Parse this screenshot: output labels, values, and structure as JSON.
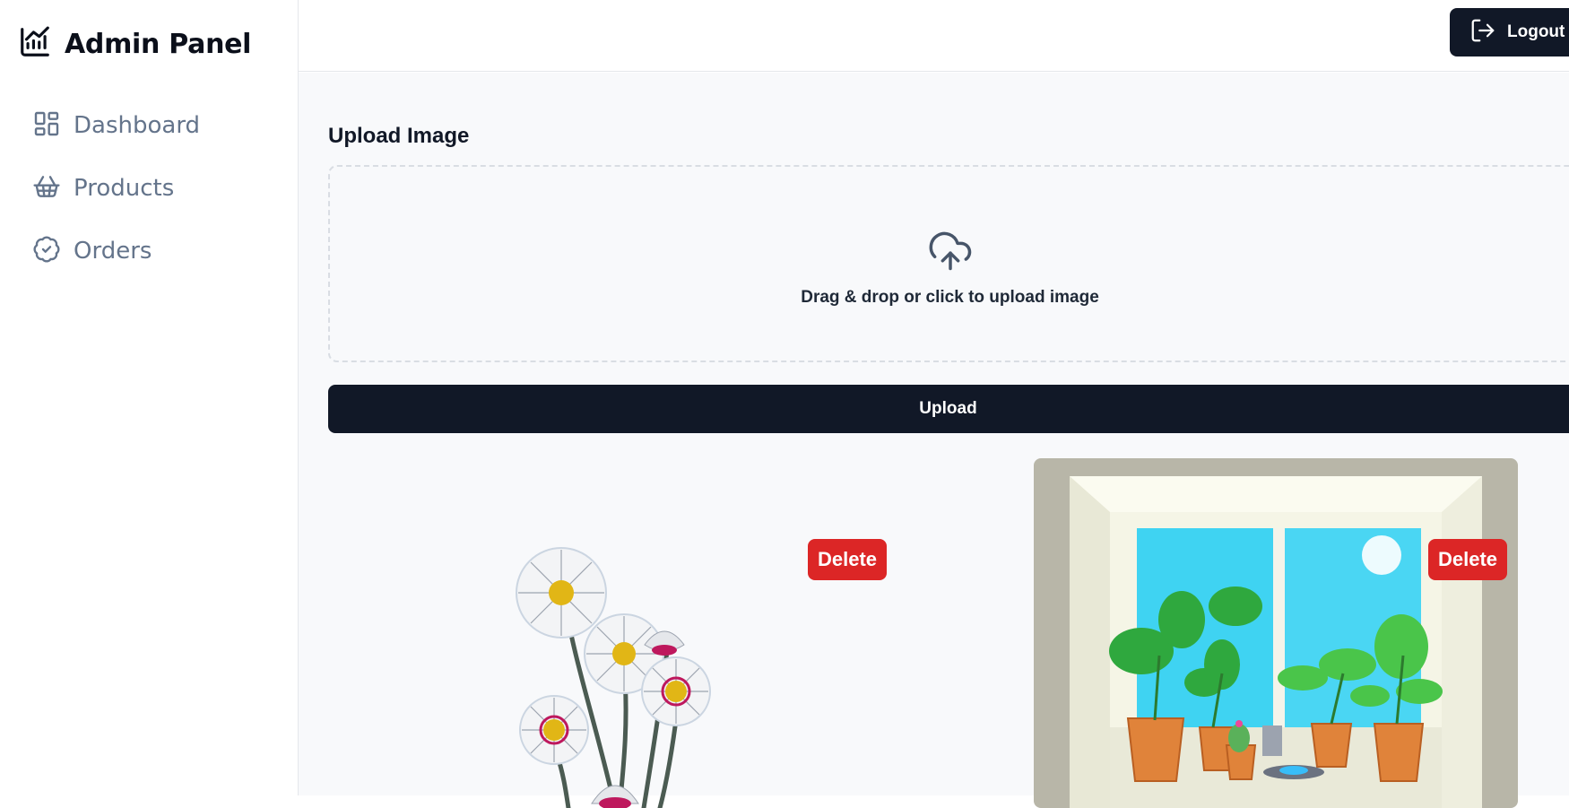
{
  "sidebar": {
    "brand_title": "Admin Panel",
    "brand_icon": "chart-line-icon",
    "items": [
      {
        "label": "Dashboard",
        "icon": "layout-dashboard-icon"
      },
      {
        "label": "Products",
        "icon": "shopping-basket-icon"
      },
      {
        "label": "Orders",
        "icon": "badge-check-icon"
      }
    ]
  },
  "header": {
    "logout_label": "Logout",
    "logout_icon": "log-out-icon"
  },
  "upload": {
    "title": "Upload Image",
    "dropzone_text": "Drag & drop or click to upload image",
    "dropzone_icon": "cloud-upload-icon",
    "button_label": "Upload"
  },
  "images": [
    {
      "delete_label": "Delete",
      "subject": "daisies"
    },
    {
      "delete_label": "Delete",
      "subject": "potted plants by window"
    }
  ],
  "colors": {
    "primary": "#111827",
    "danger": "#dc2626",
    "muted_text": "#64748b",
    "background": "#f8f9fb",
    "border": "#e5e7eb"
  }
}
